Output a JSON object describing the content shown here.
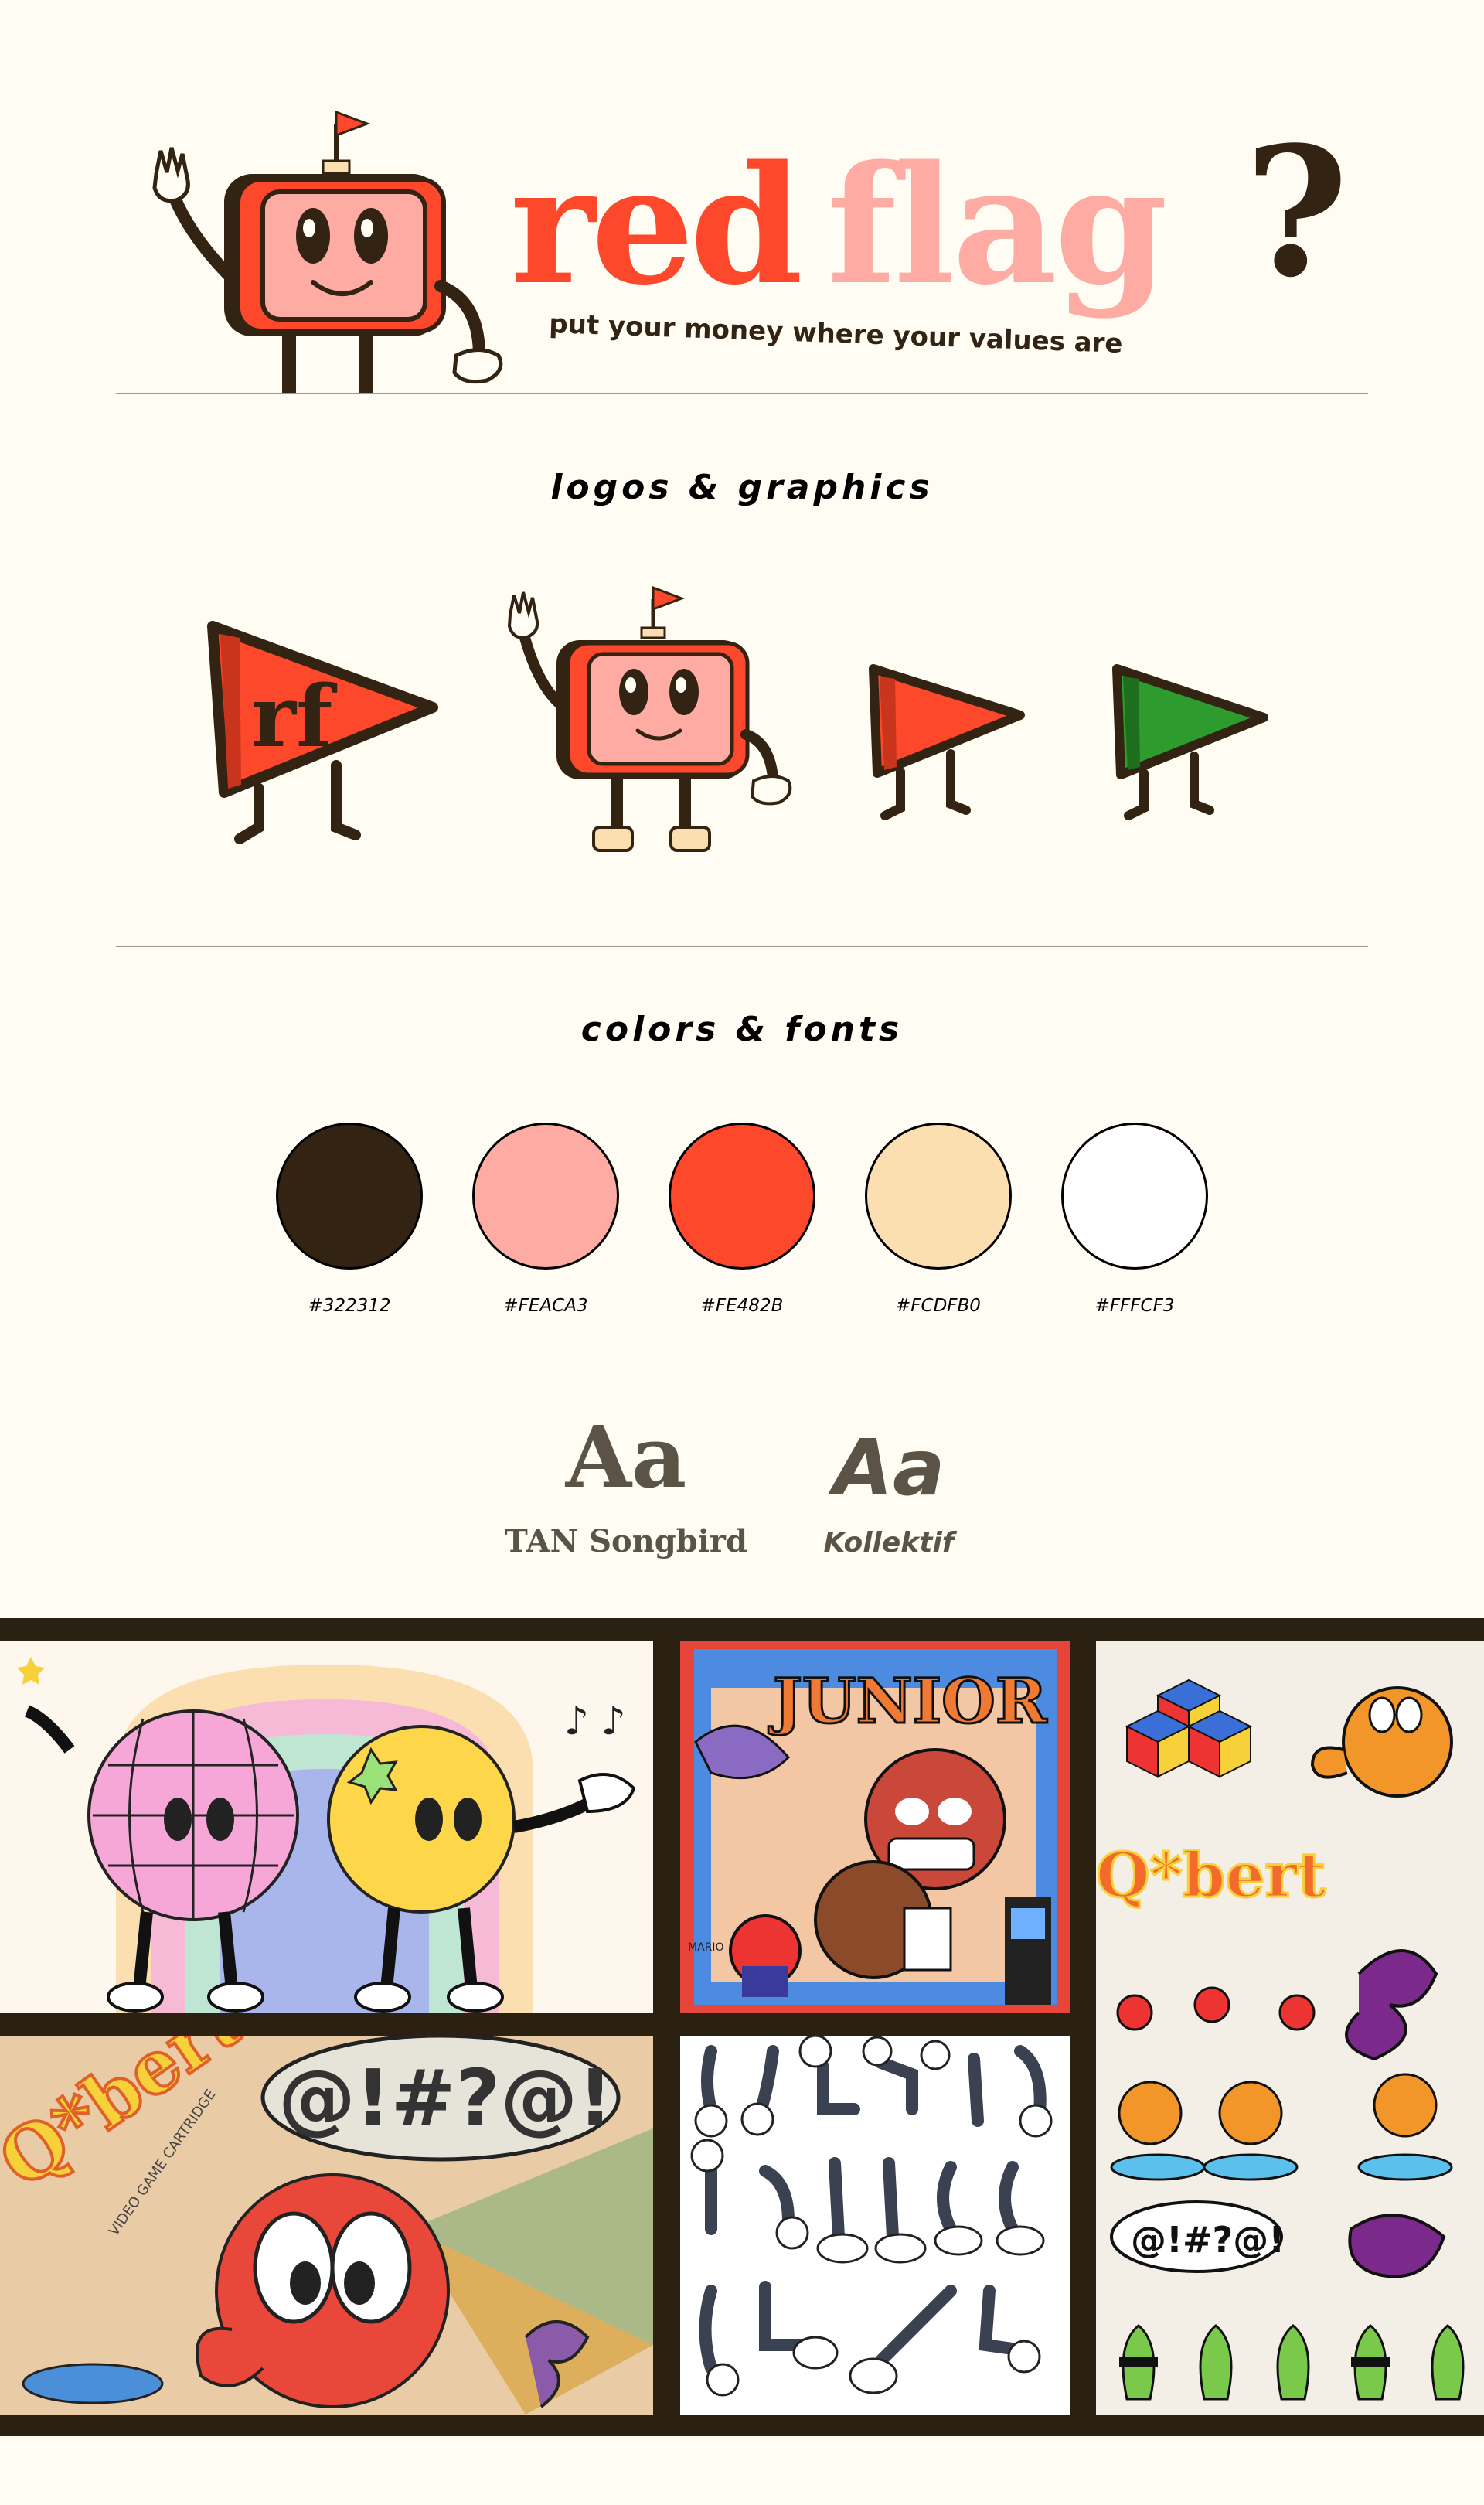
{
  "brand": {
    "name_red": "red",
    "name_pink": "flag",
    "punctuation": "?",
    "tagline": "put your money where your values are"
  },
  "sections": {
    "logos_title": "logos & graphics",
    "colors_title": "colors & fonts"
  },
  "logos": [
    {
      "name": "rf-pennant-logo",
      "monogram": "rf",
      "color": "#FE482B"
    },
    {
      "name": "tv-mascot",
      "color": "#FEACA3"
    },
    {
      "name": "red-pennant-mascot",
      "color": "#FE482B"
    },
    {
      "name": "green-pennant-mascot",
      "color": "#2E9B2E"
    }
  ],
  "palette": [
    {
      "hex": "#322312",
      "label": "#322312"
    },
    {
      "hex": "#FEACA3",
      "label": "#FEACA3"
    },
    {
      "hex": "#FE482B",
      "label": "#FE482B"
    },
    {
      "hex": "#FCDFB0",
      "label": "#FCDFB0"
    },
    {
      "hex": "#FFFCF3",
      "label": "#FFFCF3"
    }
  ],
  "fonts": [
    {
      "sample": "Aa",
      "name": "TAN Songbird"
    },
    {
      "sample": "Aa",
      "name": "Kollektif"
    }
  ],
  "moodboard": {
    "tiles": [
      {
        "name": "disco-ball-and-cookie-cartoon"
      },
      {
        "name": "donkey-kong-junior-arcade-poster",
        "title": "JUNIOR",
        "caption": "MARIO"
      },
      {
        "name": "qbert-sticker-sheet",
        "title": "Q*bert",
        "speech": "@!#?@!"
      },
      {
        "name": "qbert-game-cartridge-art",
        "title": "Q*bert",
        "subtitle": "VIDEO GAME CARTRIDGE",
        "speech": "@!#?@!"
      },
      {
        "name": "cartoon-limbs-reference-sheet"
      }
    ]
  }
}
